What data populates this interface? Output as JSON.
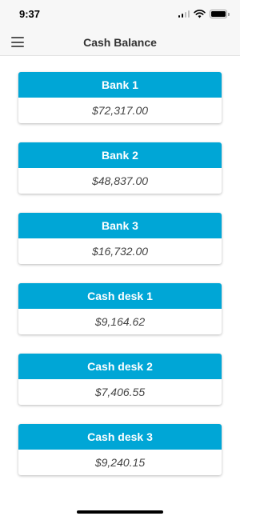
{
  "status_bar": {
    "time": "9:37",
    "icons": [
      "signal-icon",
      "wifi-icon",
      "battery-icon"
    ]
  },
  "nav": {
    "title": "Cash Balance",
    "menu_icon": "menu-icon"
  },
  "colors": {
    "accent": "#00a6d6",
    "card_text": "#444444",
    "bar_background": "#f7f7f7"
  },
  "accounts": [
    {
      "name": "Bank 1",
      "balance": "$72,317.00"
    },
    {
      "name": "Bank 2",
      "balance": "$48,837.00"
    },
    {
      "name": "Bank 3",
      "balance": "$16,732.00"
    },
    {
      "name": "Cash desk 1",
      "balance": "$9,164.62"
    },
    {
      "name": "Cash desk 2",
      "balance": "$7,406.55"
    },
    {
      "name": "Cash desk 3",
      "balance": "$9,240.15"
    }
  ]
}
